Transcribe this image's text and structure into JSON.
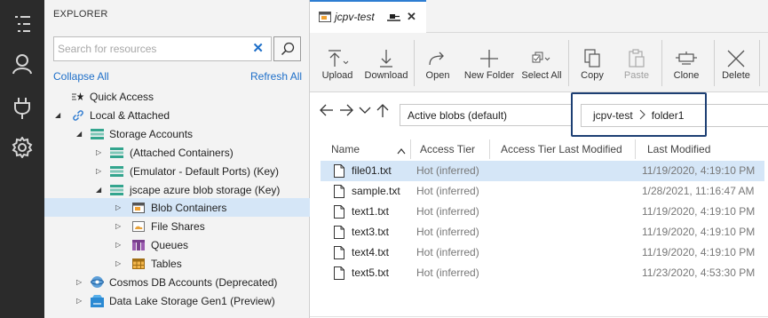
{
  "explorer": {
    "title": "EXPLORER",
    "search_placeholder": "Search for resources",
    "collapse_all": "Collapse All",
    "refresh_all": "Refresh All",
    "tree": [
      {
        "label": "Quick Access"
      },
      {
        "label": "Local & Attached"
      },
      {
        "label": "Storage Accounts"
      },
      {
        "label": "(Attached Containers)"
      },
      {
        "label": "(Emulator - Default Ports) (Key)"
      },
      {
        "label": "jscape azure blob storage (Key)"
      },
      {
        "label": "Blob Containers"
      },
      {
        "label": "File Shares"
      },
      {
        "label": "Queues"
      },
      {
        "label": "Tables"
      },
      {
        "label": "Cosmos DB Accounts (Deprecated)"
      },
      {
        "label": "Data Lake Storage Gen1 (Preview)"
      }
    ]
  },
  "tab": {
    "title": "jcpv-test"
  },
  "toolbar": {
    "upload": "Upload",
    "download": "Download",
    "open": "Open",
    "new_folder": "New Folder",
    "select_all": "Select All",
    "copy": "Copy",
    "paste": "Paste",
    "clone": "Clone",
    "delete": "Delete"
  },
  "address": {
    "view": "Active blobs (default)",
    "crumbs": [
      "jcpv-test",
      "folder1"
    ]
  },
  "table": {
    "headers": [
      "Name",
      "Access Tier",
      "Access Tier Last Modified",
      "Last Modified"
    ],
    "rows": [
      {
        "name": "file01.txt",
        "tier": "Hot (inferred)",
        "modified": "11/19/2020, 4:19:10 PM"
      },
      {
        "name": "sample.txt",
        "tier": "Hot (inferred)",
        "modified": "1/28/2021, 11:16:47 AM"
      },
      {
        "name": "text1.txt",
        "tier": "Hot (inferred)",
        "modified": "11/19/2020, 4:19:10 PM"
      },
      {
        "name": "text3.txt",
        "tier": "Hot (inferred)",
        "modified": "11/19/2020, 4:19:10 PM"
      },
      {
        "name": "text4.txt",
        "tier": "Hot (inferred)",
        "modified": "11/19/2020, 4:19:10 PM"
      },
      {
        "name": "text5.txt",
        "tier": "Hot (inferred)",
        "modified": "11/23/2020, 4:53:30 PM"
      }
    ]
  },
  "colors": {
    "accent": "#1e6fc9",
    "selection": "#d5e6f7",
    "activity_bar": "#2b2b2b"
  }
}
